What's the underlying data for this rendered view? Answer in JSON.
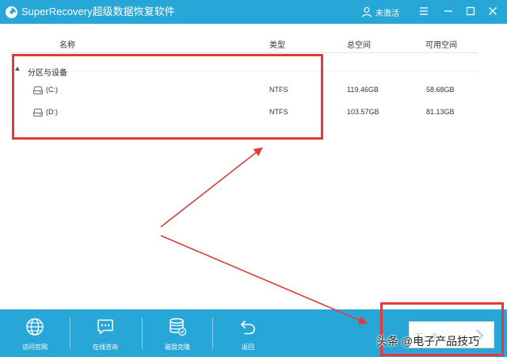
{
  "window": {
    "title": "SuperRecovery超级数据恢复软件",
    "account_label": "未激活"
  },
  "table": {
    "headers": {
      "name": "名称",
      "type": "类型",
      "total": "总空间",
      "free": "可用空间"
    },
    "group_label": "分区与设备",
    "drives": [
      {
        "name": "(C:)",
        "type": "NTFS",
        "total": "119.46GB",
        "free": "58.68GB"
      },
      {
        "name": "(D:)",
        "type": "NTFS",
        "total": "103.57GB",
        "free": "81.13GB"
      }
    ]
  },
  "toolbar": {
    "items": [
      {
        "label": "访问官网",
        "icon": "globe-icon"
      },
      {
        "label": "在线咨询",
        "icon": "chat-icon"
      },
      {
        "label": "磁盘克隆",
        "icon": "database-icon"
      },
      {
        "label": "返回",
        "icon": "back-arrow-icon"
      }
    ],
    "next_label": "下一步"
  },
  "watermark": "头条 @电子产品技巧",
  "colors": {
    "primary": "#27a6d8",
    "annotation": "#e23a3a"
  }
}
